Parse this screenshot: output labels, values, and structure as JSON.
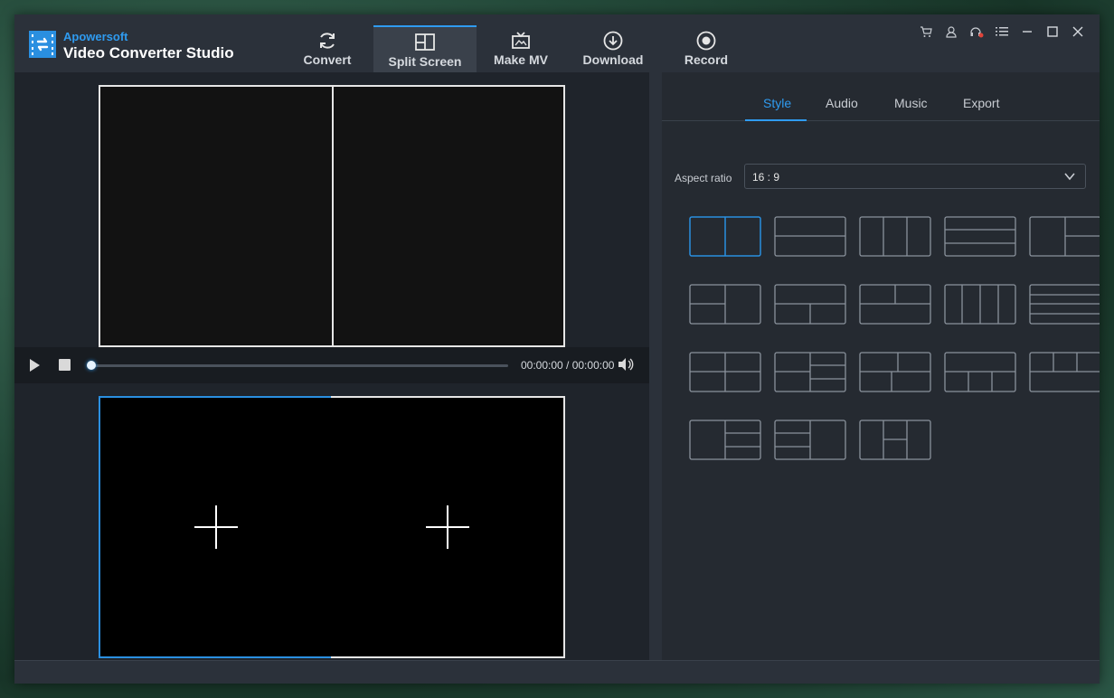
{
  "app": {
    "brand": "Apowersoft",
    "title": "Video Converter Studio"
  },
  "nav": [
    {
      "label": "Convert",
      "icon": "refresh-icon"
    },
    {
      "label": "Split Screen",
      "icon": "layout-icon"
    },
    {
      "label": "Make MV",
      "icon": "tv-icon"
    },
    {
      "label": "Download",
      "icon": "download-icon"
    },
    {
      "label": "Record",
      "icon": "record-icon"
    }
  ],
  "player": {
    "time": "00:00:00 / 00:00:00"
  },
  "panel": {
    "tabs": [
      "Style",
      "Audio",
      "Music",
      "Export"
    ],
    "active_tab": "Style",
    "aspect_label": "Aspect ratio",
    "aspect_value": "16 : 9"
  },
  "colors": {
    "accent": "#2f9bf0",
    "bg": "#2b313a"
  }
}
